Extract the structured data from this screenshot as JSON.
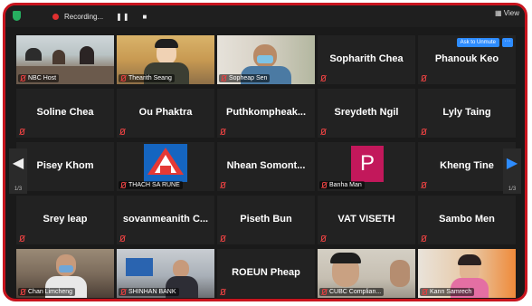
{
  "window": {
    "recording_label": "Recording...",
    "pause_symbol": "❚❚",
    "stop_symbol": "■",
    "view_label": "View"
  },
  "pagination": {
    "left": "1/3",
    "right": "1/3"
  },
  "accent": "#2d8cff",
  "tiles": [
    {
      "name": "NBC Host",
      "type": "video"
    },
    {
      "name": "Thearith Seang",
      "type": "video"
    },
    {
      "name": "Sopheap Sen",
      "type": "video"
    },
    {
      "name": "Sopharith Chea",
      "type": "name"
    },
    {
      "name": "Phanouk Keo",
      "type": "name",
      "button": "Ask to Unmute",
      "more": "···"
    },
    {
      "name": "Soline Chea",
      "type": "name"
    },
    {
      "name": "Ou Phaktra",
      "type": "name"
    },
    {
      "name": "Puthkompheak...",
      "type": "name"
    },
    {
      "name": "Sreydeth Ngil",
      "type": "name"
    },
    {
      "name": "Lyly Taing",
      "type": "name"
    },
    {
      "name": "Pisey Khom",
      "type": "name"
    },
    {
      "name": "THACH SA RUNE",
      "type": "logo"
    },
    {
      "name": "Nhean Somont...",
      "type": "name"
    },
    {
      "name": "Banha Man",
      "type": "avatar",
      "initial": "P"
    },
    {
      "name": "Kheng Tine",
      "type": "name"
    },
    {
      "name": "Srey leap",
      "type": "name"
    },
    {
      "name": "sovanmeanith C...",
      "type": "name"
    },
    {
      "name": "Piseth Bun",
      "type": "name"
    },
    {
      "name": "VAT VISETH",
      "type": "name"
    },
    {
      "name": "Sambo Men",
      "type": "name"
    },
    {
      "name": "Chan Limcheng",
      "type": "video"
    },
    {
      "name": "SHINHAN BANK",
      "type": "video"
    },
    {
      "name": "ROEUN Pheap",
      "type": "name"
    },
    {
      "name": "CUBC Complian...",
      "type": "video"
    },
    {
      "name": "Kann Samrech",
      "type": "video"
    }
  ]
}
